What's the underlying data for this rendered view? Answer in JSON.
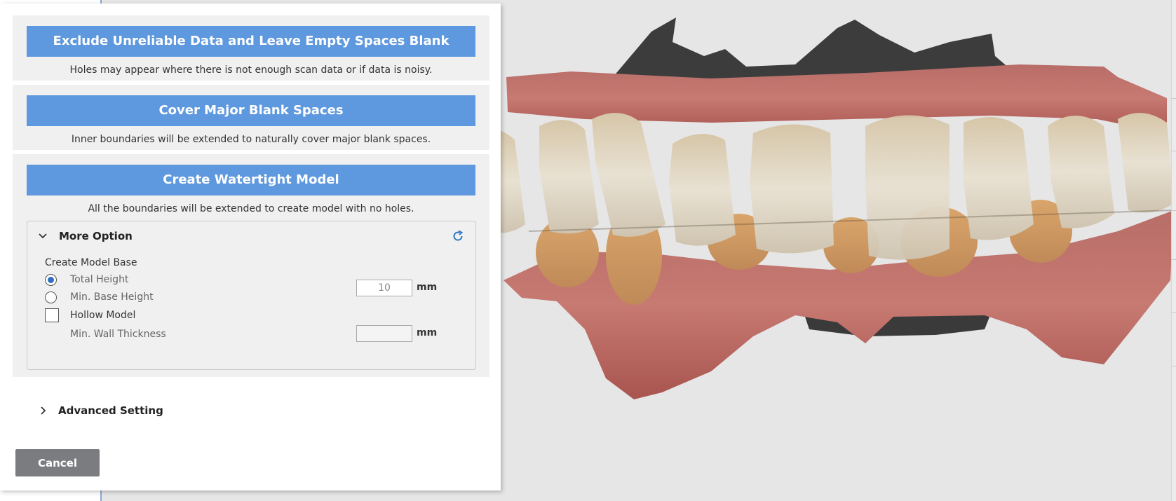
{
  "dialog": {
    "options": [
      {
        "button_label": "Exclude Unreliable Data and Leave Empty Spaces Blank",
        "description": "Holes may appear where there is not enough scan data or if data is noisy."
      },
      {
        "button_label": "Cover Major Blank Spaces",
        "description": "Inner boundaries will be extended to naturally cover major blank spaces."
      },
      {
        "button_label": "Create Watertight Model",
        "description": "All the boundaries will be extended to create model with no holes."
      }
    ],
    "more_option": {
      "title": "More Option",
      "expanded": true,
      "reset_icon": "refresh-icon",
      "create_model_base_label": "Create Model Base",
      "total_height_label": "Total Height",
      "total_height_selected": true,
      "min_base_height_label": "Min. Base Height",
      "height_value": "10",
      "height_unit": "mm",
      "hollow_model_label": "Hollow Model",
      "hollow_model_checked": false,
      "min_wall_thickness_label": "Min. Wall Thickness",
      "wall_thickness_value": "",
      "wall_thickness_unit": "mm"
    },
    "advanced_setting": {
      "title": "Advanced Setting",
      "expanded": false
    },
    "cancel_label": "Cancel"
  },
  "colors": {
    "primary_button": "#5e98de",
    "cancel_button": "#7b7c7f",
    "section_bg": "#f0f0f0",
    "radio_selected": "#2f6fc0",
    "viewport_bg": "#e6e6e6"
  },
  "viewport": {
    "content": "dental-scan-3d-model"
  }
}
